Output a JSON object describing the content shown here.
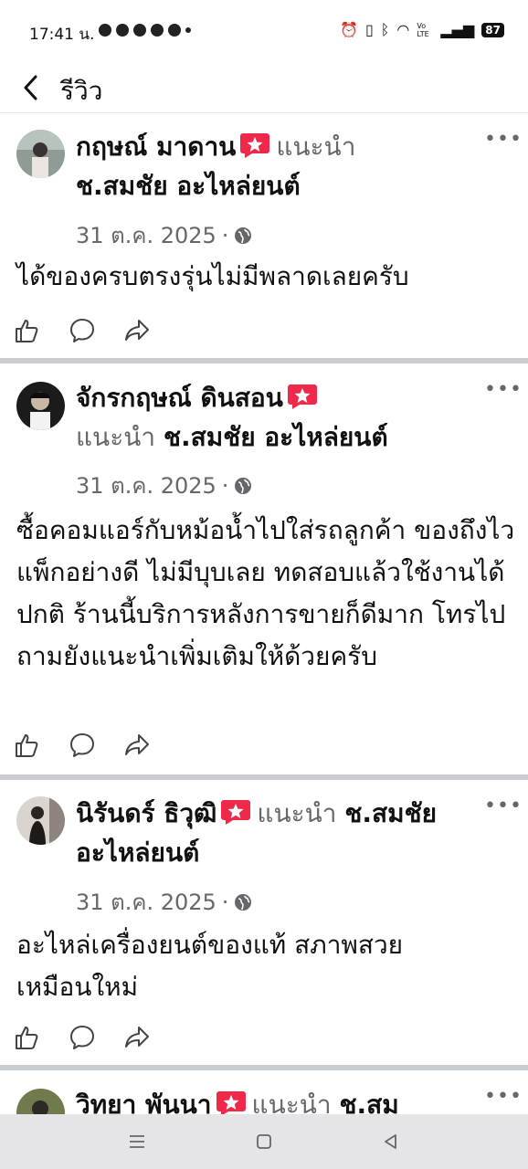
{
  "status_bar": {
    "time": "17:41 น.",
    "battery": "87",
    "volte": "Vo LTE"
  },
  "header": {
    "title": "รีวิว"
  },
  "reviews": [
    {
      "reviewer": "กฤษณ์ มาดาน",
      "recommends": "แนะนำ",
      "page": "ช.สมชัย อะไหล่ยนต์",
      "date": "31 ต.ค. 2025",
      "separator": "·",
      "text": "ได้ของครบตรงรุ่นไม่มีพลาดเลยครับ"
    },
    {
      "reviewer": "จักรกฤษณ์ ดินสอน",
      "recommends": "แนะนำ",
      "page": "ช.สมชัย อะไหล่ยนต์",
      "date": "31 ต.ค. 2025",
      "separator": "·",
      "text": "ซื้อคอมแอร์กับหม้อน้ำไปใส่รถลูกค้า ของถึงไว แพ็กอย่างดี ไม่มีบุบเลย ทดสอบแล้วใช้งานได้ปกติ ร้านนี้บริการหลังการขายก็ดีมาก โทรไปถามยังแนะนำเพิ่มเติมให้ด้วยครับ"
    },
    {
      "reviewer": "นิรันดร์ ธิวุฒิ",
      "recommends": "แนะนำ",
      "page": "ช.สมชัย อะไหล่ยนต์",
      "date": "31 ต.ค. 2025",
      "separator": "·",
      "text": "อะไหล่เครื่องยนต์ของแท้ สภาพสวยเหมือนใหม่"
    },
    {
      "reviewer": "วิทยา พันนา",
      "recommends": "แนะนำ",
      "page": "ช.สม"
    }
  ],
  "colors": {
    "badge": "#f02849",
    "secondary_text": "#65676b",
    "divider": "#c9ccd1"
  },
  "icons": [
    "back-arrow-icon",
    "recommend-badge-icon",
    "globe-icon",
    "like-icon",
    "comment-icon",
    "share-icon",
    "more-icon"
  ]
}
